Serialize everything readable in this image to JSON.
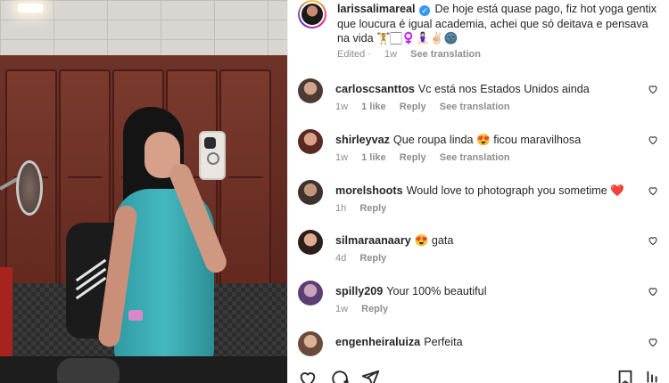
{
  "caption": {
    "username": "larissalimareal",
    "text": "De hoje está quase pago, fiz hot yoga gentix que loucura é igual academia, achei que só deitava e pensava na vida",
    "emojis": "🏋️🏻‍♀️🧘🏻‍♀️✌🏻🌚",
    "edited": "Edited",
    "time": "1w",
    "see_translation": "See translation"
  },
  "comments": [
    {
      "user": "carloscsanttos",
      "text": "Vc está nos Estados Unidos ainda",
      "time": "1w",
      "likes": "1 like",
      "reply": "Reply",
      "translate": "See translation",
      "avatar_color": "#7b6a5e"
    },
    {
      "user": "shirleyvaz",
      "text": "Que roupa linda 😍 ficou maravilhosa",
      "time": "1w",
      "likes": "1 like",
      "reply": "Reply",
      "translate": "See translation",
      "avatar_color": "#8a5a4a"
    },
    {
      "user": "morelshoots",
      "text": "Would love to photograph you sometime ❤️",
      "time": "1h",
      "likes": "",
      "reply": "Reply",
      "translate": "",
      "avatar_color": "#6b5a4f"
    },
    {
      "user": "silmaraanaary",
      "text": "😍 gata",
      "time": "4d",
      "likes": "",
      "reply": "Reply",
      "translate": "",
      "avatar_color": "#a2675a"
    },
    {
      "user": "spilly209",
      "text": "Your 100% beautiful",
      "time": "1w",
      "likes": "",
      "reply": "Reply",
      "translate": "",
      "avatar_color": "#7a5fa0"
    },
    {
      "user": "engenheiraluiza",
      "text": "Perfeita",
      "time": "",
      "likes": "",
      "reply": "",
      "translate": "",
      "avatar_color": "#b08a6e"
    }
  ],
  "icons": {
    "like": "heart-icon",
    "comment": "comment-icon",
    "share": "share-icon",
    "save": "bookmark-icon",
    "more": "more-icon"
  }
}
